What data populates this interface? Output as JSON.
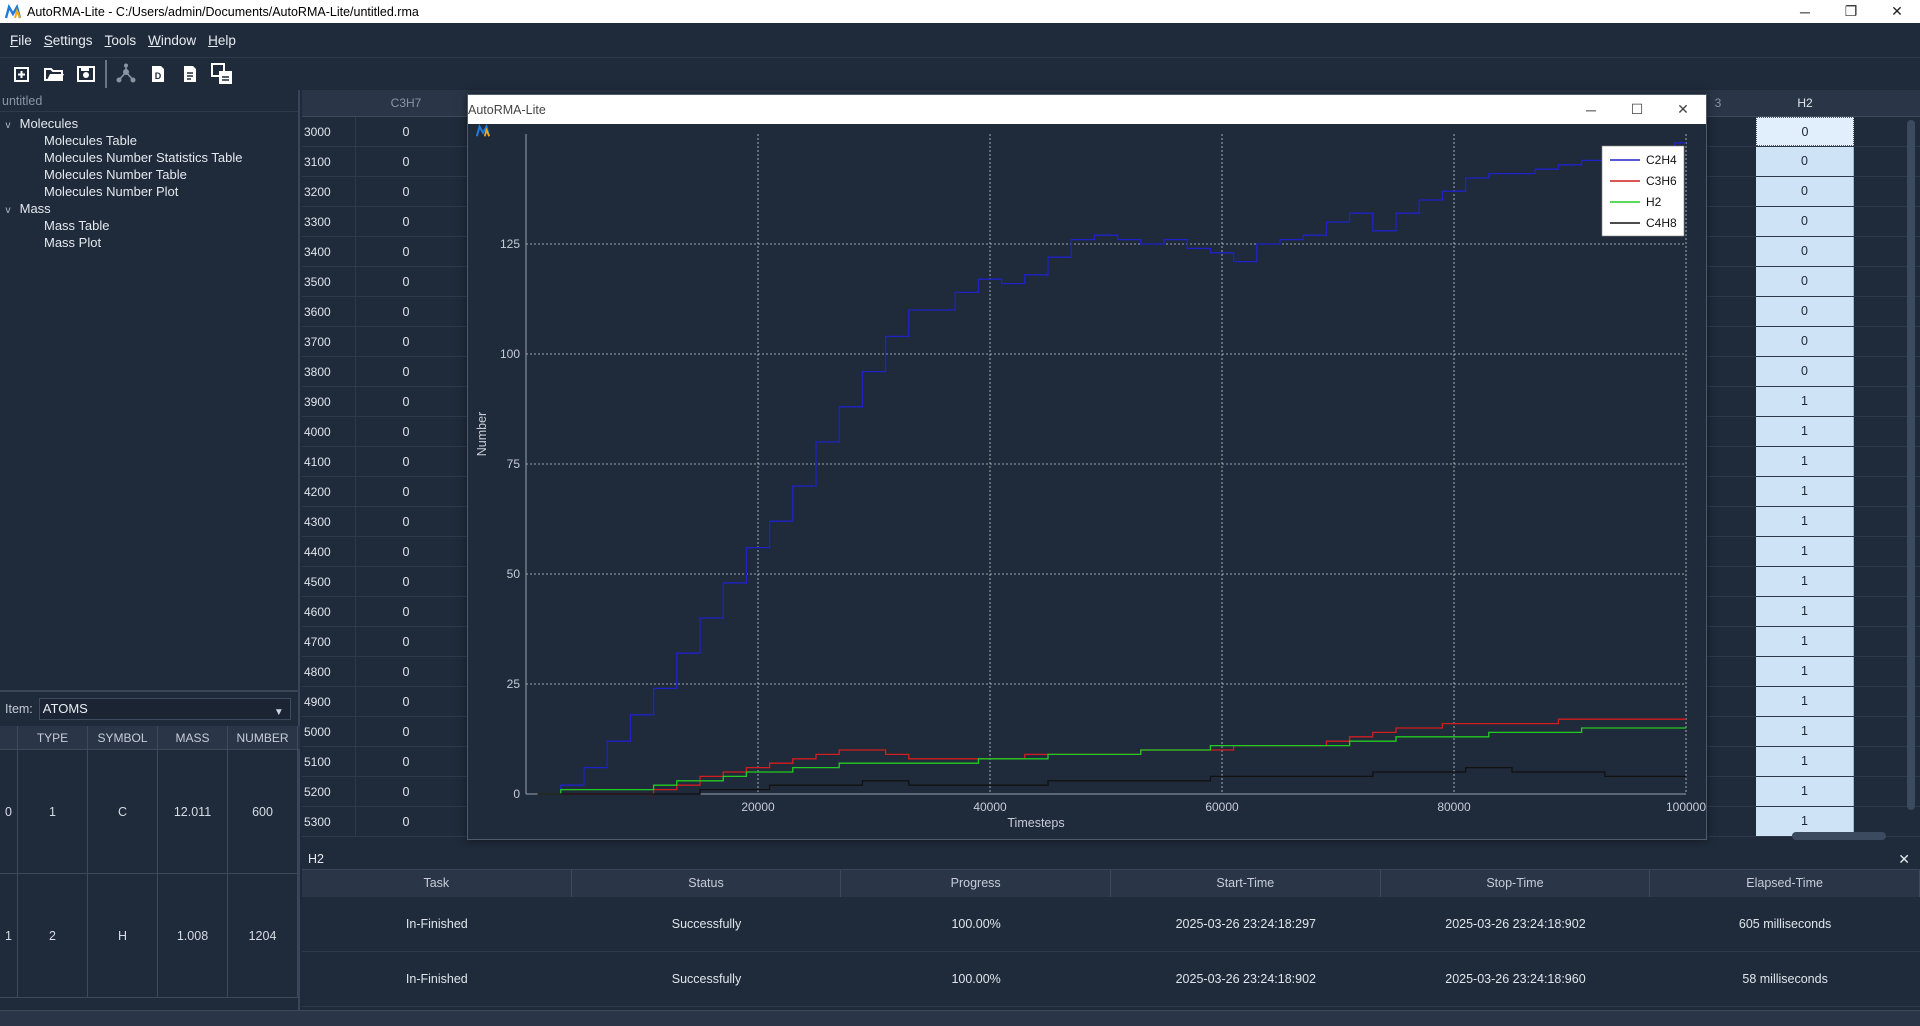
{
  "window": {
    "title": "AutoRMA-Lite - C:/Users/admin/Documents/AutoRMA-Lite/untitled.rma",
    "minimize": "─",
    "restore": "❐",
    "close": "✕"
  },
  "menu": [
    "File",
    "Settings",
    "Tools",
    "Window",
    "Help"
  ],
  "toolbar_icons": [
    "new-file-icon",
    "open-folder-icon",
    "save-icon",
    "molecule-icon",
    "d-icon",
    "document-icon",
    "export-icon"
  ],
  "tree": {
    "header": "untitled",
    "groups": [
      {
        "label": "Molecules",
        "arrow": "v",
        "children": [
          "Molecules Table",
          "Molecules Number Statistics Table",
          "Molecules Number Table",
          "Molecules Number Plot"
        ]
      },
      {
        "label": "Mass",
        "arrow": "v",
        "children": [
          "Mass Table",
          "Mass Plot"
        ]
      }
    ]
  },
  "item_selector": {
    "label": "Item:",
    "value": "ATOMS"
  },
  "atoms_table": {
    "columns": [
      "TYPE",
      "SYMBOL",
      "MASS",
      "NUMBER"
    ],
    "rows": [
      {
        "index": "0",
        "type": "1",
        "symbol": "C",
        "mass": "12.011",
        "number": "600"
      },
      {
        "index": "1",
        "type": "2",
        "symbol": "H",
        "mass": "1.008",
        "number": "1204"
      }
    ]
  },
  "data_grid": {
    "col_left": "C3H7",
    "col_right": "H2",
    "col_partial": "3",
    "rows": [
      {
        "t": "3000",
        "c3h7": "0",
        "h2": "0"
      },
      {
        "t": "3100",
        "c3h7": "0",
        "h2": "0"
      },
      {
        "t": "3200",
        "c3h7": "0",
        "h2": "0"
      },
      {
        "t": "3300",
        "c3h7": "0",
        "h2": "0"
      },
      {
        "t": "3400",
        "c3h7": "0",
        "h2": "0"
      },
      {
        "t": "3500",
        "c3h7": "0",
        "h2": "0"
      },
      {
        "t": "3600",
        "c3h7": "0",
        "h2": "0"
      },
      {
        "t": "3700",
        "c3h7": "0",
        "h2": "0"
      },
      {
        "t": "3800",
        "c3h7": "0",
        "h2": "0"
      },
      {
        "t": "3900",
        "c3h7": "0",
        "h2": "1"
      },
      {
        "t": "4000",
        "c3h7": "0",
        "h2": "1"
      },
      {
        "t": "4100",
        "c3h7": "0",
        "h2": "1"
      },
      {
        "t": "4200",
        "c3h7": "0",
        "h2": "1"
      },
      {
        "t": "4300",
        "c3h7": "0",
        "h2": "1"
      },
      {
        "t": "4400",
        "c3h7": "0",
        "h2": "1"
      },
      {
        "t": "4500",
        "c3h7": "0",
        "h2": "1"
      },
      {
        "t": "4600",
        "c3h7": "0",
        "h2": "1"
      },
      {
        "t": "4700",
        "c3h7": "0",
        "h2": "1"
      },
      {
        "t": "4800",
        "c3h7": "0",
        "h2": "1"
      },
      {
        "t": "4900",
        "c3h7": "0",
        "h2": "1"
      },
      {
        "t": "5000",
        "c3h7": "0",
        "h2": "1"
      },
      {
        "t": "5100",
        "c3h7": "0",
        "h2": "1"
      },
      {
        "t": "5200",
        "c3h7": "0",
        "h2": "1"
      },
      {
        "t": "5300",
        "c3h7": "0",
        "h2": "1"
      }
    ]
  },
  "plot_window": {
    "title": "AutoRMA-Lite",
    "minimize": "─",
    "maximize": "☐",
    "close": "✕"
  },
  "chart_data": {
    "type": "line",
    "title": "",
    "xlabel": "Timesteps",
    "ylabel": "Number",
    "xlim": [
      0,
      100000
    ],
    "ylim": [
      0,
      150
    ],
    "xticks": [
      20000,
      40000,
      60000,
      80000,
      100000
    ],
    "yticks": [
      0,
      25,
      50,
      75,
      100,
      125
    ],
    "grid": true,
    "legend_position": "top-right",
    "x": [
      1000,
      3000,
      5000,
      7000,
      9000,
      11000,
      13000,
      15000,
      17000,
      19000,
      21000,
      23000,
      25000,
      27000,
      29000,
      31000,
      33000,
      35000,
      37000,
      39000,
      41000,
      43000,
      45000,
      47000,
      49000,
      51000,
      53000,
      55000,
      57000,
      59000,
      61000,
      63000,
      65000,
      67000,
      69000,
      71000,
      73000,
      75000,
      77000,
      79000,
      81000,
      83000,
      85000,
      87000,
      89000,
      91000,
      93000,
      95000,
      97000,
      99000,
      100000
    ],
    "series": [
      {
        "name": "C2H4",
        "color": "#1f22c8",
        "values": [
          0,
          2,
          6,
          12,
          18,
          24,
          32,
          40,
          48,
          56,
          62,
          70,
          80,
          88,
          96,
          104,
          110,
          110,
          114,
          117,
          116,
          118,
          122,
          126,
          127,
          126,
          125,
          126,
          124,
          123,
          121,
          125,
          126,
          127,
          130,
          132,
          128,
          132,
          135,
          137,
          140,
          141,
          141,
          142,
          143,
          144,
          146,
          146,
          147,
          148,
          148
        ]
      },
      {
        "name": "C3H6",
        "color": "#d21e1e",
        "values": [
          0,
          0,
          0,
          0,
          0,
          1,
          2,
          4,
          5,
          6,
          7,
          8,
          9,
          10,
          10,
          9,
          8,
          8,
          8,
          8,
          8,
          9,
          9,
          9,
          9,
          9,
          10,
          10,
          10,
          10,
          11,
          11,
          11,
          11,
          12,
          13,
          14,
          15,
          15,
          16,
          16,
          16,
          16,
          16,
          17,
          17,
          17,
          17,
          17,
          17,
          17
        ]
      },
      {
        "name": "H2",
        "color": "#22cc22",
        "values": [
          0,
          1,
          1,
          1,
          1,
          2,
          3,
          3,
          4,
          5,
          5,
          6,
          6,
          7,
          7,
          7,
          7,
          7,
          7,
          8,
          8,
          8,
          9,
          9,
          9,
          9,
          10,
          10,
          10,
          11,
          11,
          11,
          11,
          11,
          11,
          12,
          12,
          13,
          13,
          13,
          13,
          14,
          14,
          14,
          14,
          15,
          15,
          15,
          15,
          15,
          15
        ]
      },
      {
        "name": "C4H8",
        "color": "#111111",
        "values": [
          0,
          0,
          0,
          0,
          0,
          0,
          0,
          1,
          1,
          1,
          2,
          2,
          2,
          2,
          3,
          3,
          2,
          2,
          2,
          2,
          2,
          2,
          3,
          3,
          3,
          3,
          3,
          3,
          3,
          4,
          4,
          4,
          4,
          4,
          4,
          4,
          5,
          5,
          5,
          5,
          6,
          6,
          5,
          5,
          5,
          5,
          4,
          4,
          4,
          4,
          4
        ]
      }
    ]
  },
  "status": {
    "title": "H2",
    "close": "✕",
    "columns": [
      "Task",
      "Status",
      "Progress",
      "Start-Time",
      "Stop-Time",
      "Elapsed-Time"
    ],
    "rows": [
      [
        "In-Finished",
        "Successfully",
        "100.00%",
        "2025-03-26 23:24:18:297",
        "2025-03-26 23:24:18:902",
        "605 milliseconds"
      ],
      [
        "In-Finished",
        "Successfully",
        "100.00%",
        "2025-03-26 23:24:18:902",
        "2025-03-26 23:24:18:960",
        "58 milliseconds"
      ]
    ]
  }
}
